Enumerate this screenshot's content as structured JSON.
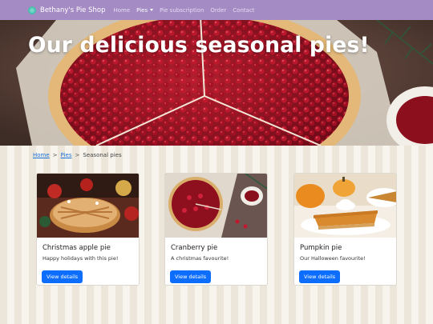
{
  "navbar": {
    "brand": "Bethany's Pie Shop",
    "links": [
      {
        "label": "Home"
      },
      {
        "label": "Pies"
      },
      {
        "label": "Pie subscription"
      },
      {
        "label": "Order"
      },
      {
        "label": "Contact"
      }
    ],
    "icon": "pie-logo-icon",
    "background_color": "#a48bc4"
  },
  "hero": {
    "title": "Our delicious seasonal pies!"
  },
  "breadcrumb": {
    "items": [
      "Home",
      "Pies",
      "Seasonal pies"
    ],
    "separator": ">"
  },
  "cards": [
    {
      "title": "Christmas apple pie",
      "text": "Happy holidays with this pie!",
      "button": "View details"
    },
    {
      "title": "Cranberry pie",
      "text": "A christmas favourite!",
      "button": "View details"
    },
    {
      "title": "Pumpkin pie",
      "text": "Our Halloween favourite!",
      "button": "View details"
    }
  ],
  "colors": {
    "accent": "#0d6efd",
    "link": "#1a6fd8"
  }
}
